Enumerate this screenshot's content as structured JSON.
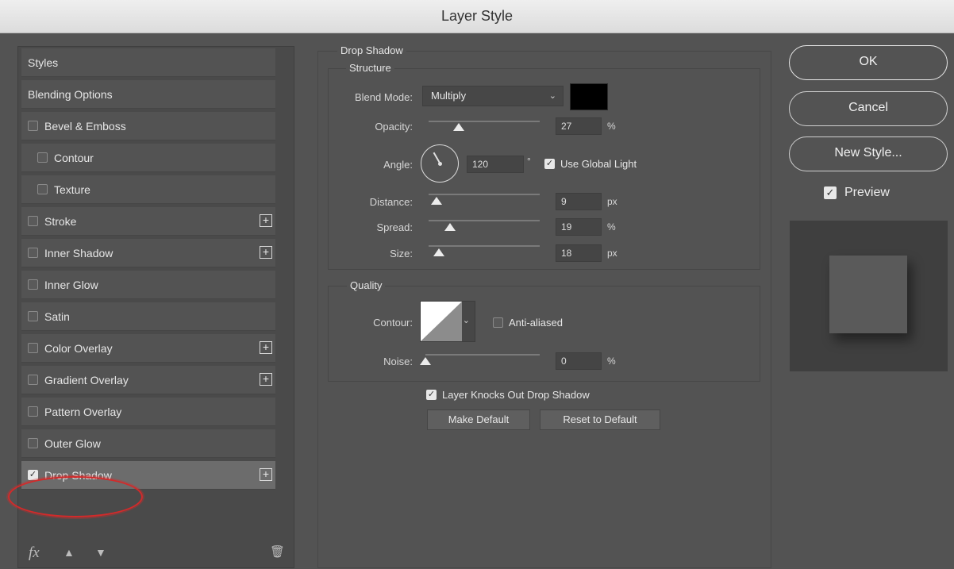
{
  "window": {
    "title": "Layer Style"
  },
  "styles_list": {
    "items": [
      {
        "label": "Styles",
        "checkbox": false,
        "checked": false,
        "indent": 0,
        "plus": false,
        "selected": false
      },
      {
        "label": "Blending Options",
        "checkbox": false,
        "checked": false,
        "indent": 0,
        "plus": false,
        "selected": false
      },
      {
        "label": "Bevel & Emboss",
        "checkbox": true,
        "checked": false,
        "indent": 0,
        "plus": false,
        "selected": false
      },
      {
        "label": "Contour",
        "checkbox": true,
        "checked": false,
        "indent": 1,
        "plus": false,
        "selected": false
      },
      {
        "label": "Texture",
        "checkbox": true,
        "checked": false,
        "indent": 1,
        "plus": false,
        "selected": false
      },
      {
        "label": "Stroke",
        "checkbox": true,
        "checked": false,
        "indent": 0,
        "plus": true,
        "selected": false
      },
      {
        "label": "Inner Shadow",
        "checkbox": true,
        "checked": false,
        "indent": 0,
        "plus": true,
        "selected": false
      },
      {
        "label": "Inner Glow",
        "checkbox": true,
        "checked": false,
        "indent": 0,
        "plus": false,
        "selected": false
      },
      {
        "label": "Satin",
        "checkbox": true,
        "checked": false,
        "indent": 0,
        "plus": false,
        "selected": false
      },
      {
        "label": "Color Overlay",
        "checkbox": true,
        "checked": false,
        "indent": 0,
        "plus": true,
        "selected": false
      },
      {
        "label": "Gradient Overlay",
        "checkbox": true,
        "checked": false,
        "indent": 0,
        "plus": true,
        "selected": false
      },
      {
        "label": "Pattern Overlay",
        "checkbox": true,
        "checked": false,
        "indent": 0,
        "plus": false,
        "selected": false
      },
      {
        "label": "Outer Glow",
        "checkbox": true,
        "checked": false,
        "indent": 0,
        "plus": false,
        "selected": false
      },
      {
        "label": "Drop Shadow",
        "checkbox": true,
        "checked": true,
        "indent": 0,
        "plus": true,
        "selected": true
      }
    ],
    "toolbar": {
      "fx_label": "fx"
    }
  },
  "drop_shadow": {
    "group_title": "Drop Shadow",
    "structure": {
      "title": "Structure",
      "blend_mode_label": "Blend Mode:",
      "blend_mode_value": "Multiply",
      "shadow_color": "#000000",
      "opacity_label": "Opacity:",
      "opacity_value": "27",
      "opacity_unit": "%",
      "opacity_fraction": 0.27,
      "angle_label": "Angle:",
      "angle_value": "120",
      "angle_unit": "°",
      "use_global_light_label": "Use Global Light",
      "use_global_light_checked": true,
      "distance_label": "Distance:",
      "distance_value": "9",
      "distance_unit": "px",
      "distance_fraction": 0.07,
      "spread_label": "Spread:",
      "spread_value": "19",
      "spread_unit": "%",
      "spread_fraction": 0.19,
      "size_label": "Size:",
      "size_value": "18",
      "size_unit": "px",
      "size_fraction": 0.09
    },
    "quality": {
      "title": "Quality",
      "contour_label": "Contour:",
      "anti_aliased_label": "Anti-aliased",
      "anti_aliased_checked": false,
      "noise_label": "Noise:",
      "noise_value": "0",
      "noise_unit": "%",
      "noise_fraction": 0.0
    },
    "knocks_out_label": "Layer Knocks Out Drop Shadow",
    "knocks_out_checked": true,
    "make_default_label": "Make Default",
    "reset_default_label": "Reset to Default"
  },
  "actions": {
    "ok_label": "OK",
    "cancel_label": "Cancel",
    "new_style_label": "New Style...",
    "preview_label": "Preview",
    "preview_checked": true
  },
  "colors": {
    "dialog_bg": "#535353",
    "highlight_ring": "#d32a2a"
  }
}
